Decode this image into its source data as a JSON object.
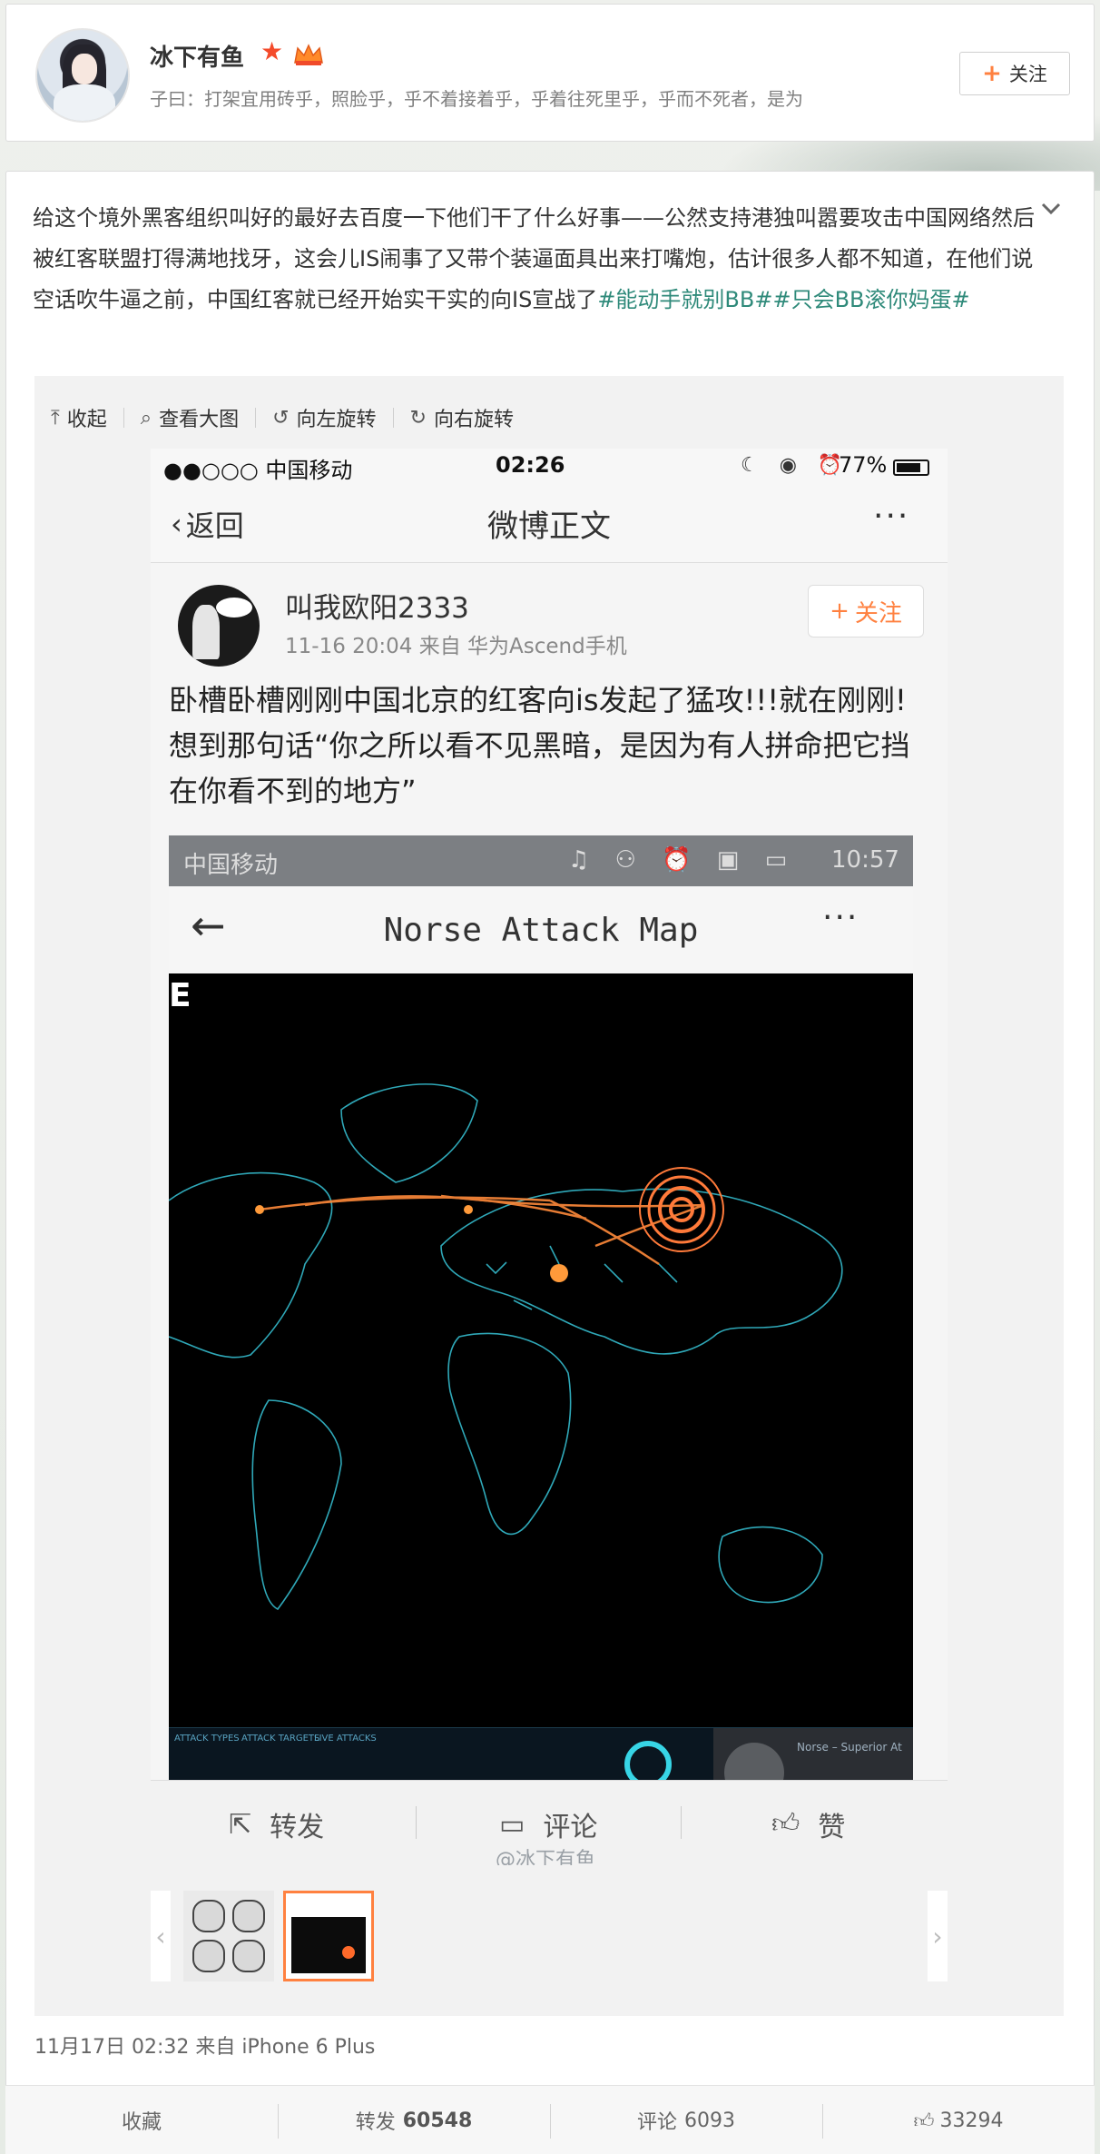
{
  "user": {
    "name": "冰下有鱼",
    "bio": "子曰：打架宜用砖乎，照脸乎，乎不着接着乎，乎着往死里乎，乎而不死者，是为",
    "follow_label": "关注"
  },
  "post": {
    "text": "给这个境外黑客组织叫好的最好去百度一下他们干了什么好事——公然支持港独叫嚣要攻击中国网络然后被红客联盟打得满地找牙，这会儿IS闹事了又带个装逼面具出来打嘴炮，估计很多人都不知道，在他们说空话吹牛逼之前，中国红客就已经开始实干实的向IS宣战了",
    "tags": "#能动手就别BB##只会BB滚你妈蛋#",
    "meta": "11月17日 02:32 来自 iPhone 6 Plus"
  },
  "media_toolbar": {
    "collapse": "收起",
    "view_large": "查看大图",
    "rotate_left": "向左旋转",
    "rotate_right": "向右旋转"
  },
  "screenshot": {
    "carrier": "●●○○○ 中国移动",
    "time": "02:26",
    "battery": "77%",
    "back": "返回",
    "nav_title": "微博正文",
    "inner_user": "叫我欧阳2333",
    "inner_meta": "11-16 20:04  来自 华为Ascend手机",
    "inner_follow": "关注",
    "inner_text": "卧槽卧槽刚刚中国北京的红客向is发起了猛攻!!!就在刚刚!想到那句话“你之所以看不见黑暗，是因为有人拼命把它挡在你看不到的地方”",
    "map_carrier": "中国移动",
    "map_time": "10:57",
    "map_title": "Norse Attack Map",
    "map_letter": "E",
    "map_footer_right": "Norse – Superior At",
    "actions": {
      "repost": "转发",
      "comment": "评论",
      "like": "赞"
    },
    "watermark": "@冰下有鱼"
  },
  "stats": {
    "favorite": "收藏",
    "repost_label": "转发",
    "repost_count": "60548",
    "comment_label": "评论",
    "comment_count": "6093",
    "like_count": "33294"
  },
  "colors": {
    "accent": "#ff8140",
    "tag": "#2f8a7a",
    "map_line": "#3fbcc8",
    "attack": "#ff7a3a"
  }
}
